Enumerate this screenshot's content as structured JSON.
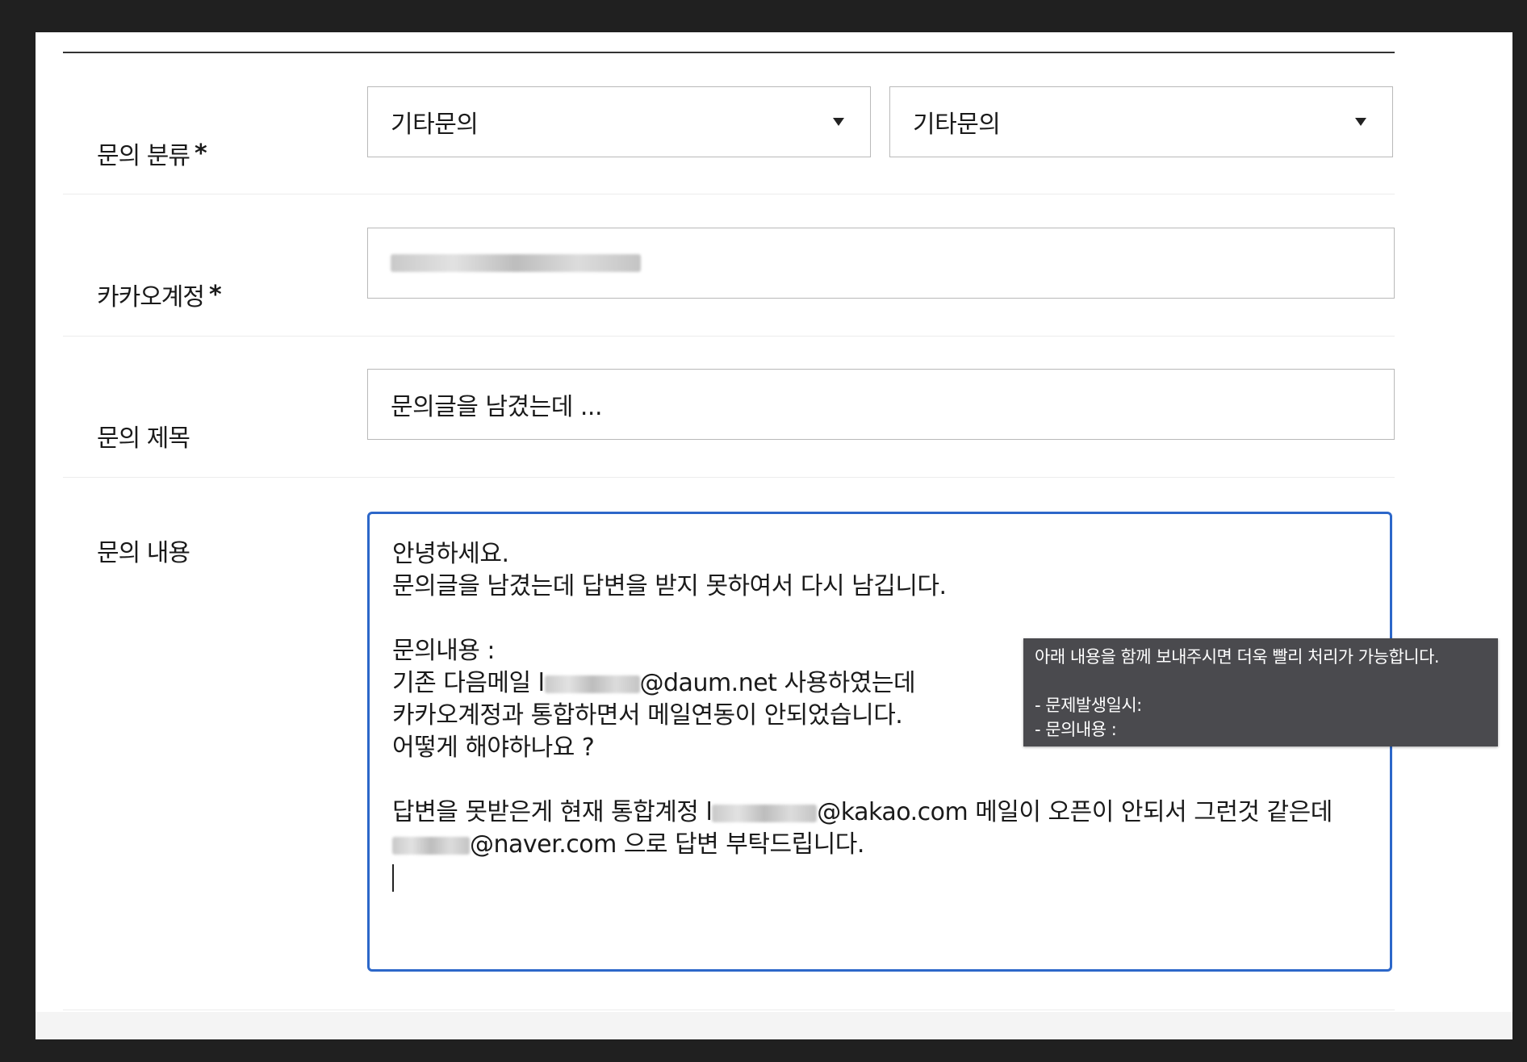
{
  "form": {
    "category": {
      "label": "문의 분류",
      "required_mark": "*",
      "primary_value": "기타문의",
      "secondary_value": "기타문의"
    },
    "kakao_account": {
      "label": "카카오계정",
      "required_mark": "*",
      "value": "[redacted]@kakao.com"
    },
    "subject": {
      "label": "문의 제목",
      "value": "문의글을 남겼는데 ..."
    },
    "content": {
      "label": "문의 내용",
      "lines": {
        "l1": "안녕하세요.",
        "l2": "문의글을 남겼는데 답변을 받지 못하여서 다시 남깁니다.",
        "l3": "문의내용 :",
        "l4_prefix": "기존 다음메일 l",
        "l4_suffix": "@daum.net 사용하였는데",
        "l5": "카카오계정과 통합하면서 메일연동이 안되었습니다.",
        "l6": "어떻게 해야하나요 ?",
        "l7_prefix": "답변을 못받은게 현재 통합계정 l",
        "l7_suffix": "@kakao.com 메일이 오픈이 안되서 그런것 같은데",
        "l8_suffix": "@naver.com 으로 답변 부탁드립니다."
      }
    }
  },
  "tooltip": {
    "line1": "아래 내용을 함께 보내주시면 더욱 빨리 처리가 가능합니다.",
    "line2": "- 문제발생일시:",
    "line3": "- 문의내용 :"
  },
  "colors": {
    "focus_border": "#2c67c9",
    "tooltip_bg": "#4a4a4e",
    "outer_bg": "#202020"
  }
}
